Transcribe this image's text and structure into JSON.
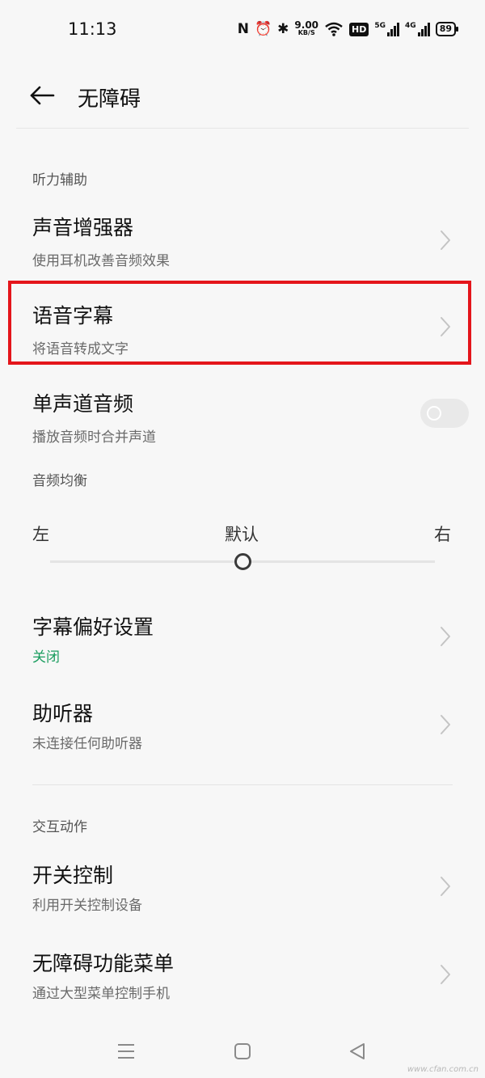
{
  "status_bar": {
    "time": "11:13",
    "net_speed": "9.00",
    "net_unit": "KB/S",
    "hd": "HD",
    "sig1": "5G",
    "sig2": "4G",
    "battery": "89",
    "nfc_icon": "N",
    "alarm_icon": "⏰",
    "bt_icon": "✱"
  },
  "header": {
    "title": "无障碍"
  },
  "sections": {
    "hearing": "听力辅助",
    "balance": "音频均衡",
    "interaction": "交互动作"
  },
  "items": [
    {
      "title": "声音增强器",
      "subtitle": "使用耳机改善音频效果"
    },
    {
      "title": "语音字幕",
      "subtitle": "将语音转成文字"
    },
    {
      "title": "单声道音频",
      "subtitle": "播放音频时合并声道",
      "toggle_on": false
    },
    {
      "title": "字幕偏好设置",
      "subtitle": "关闭"
    },
    {
      "title": "助听器",
      "subtitle": "未连接任何助听器"
    },
    {
      "title": "开关控制",
      "subtitle": "利用开关控制设备"
    },
    {
      "title": "无障碍功能菜单",
      "subtitle": "通过大型菜单控制手机"
    }
  ],
  "balance": {
    "left": "左",
    "center": "默认",
    "right": "右",
    "value": 0.5
  },
  "colors": {
    "highlight": "#e4151b",
    "accent_green": "#1a9d5f"
  },
  "watermark": "www.cfan.com.cn"
}
